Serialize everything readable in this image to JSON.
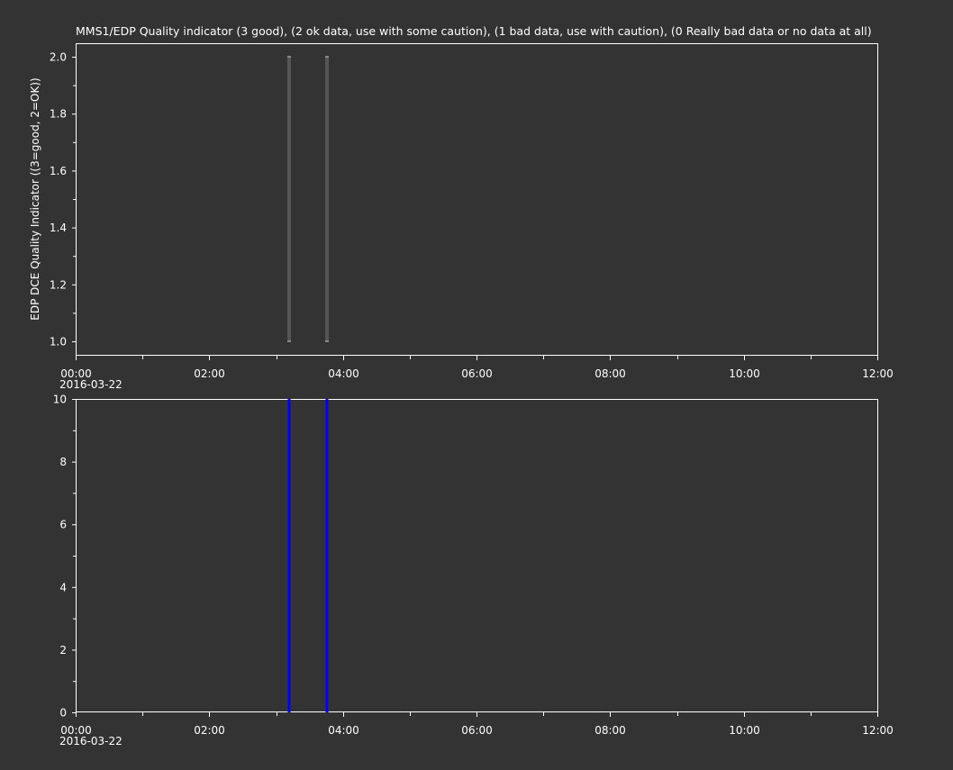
{
  "chart_data": [
    {
      "type": "line",
      "title": "MMS1/EDP  Quality indicator (3 good), (2 ok data, use with some caution), (1 bad data, use with caution), (0 Really bad data or no data at all)",
      "ylabel": "EDP DCE Quality Indicator ((3=good, 2=OK))",
      "xlabel": "",
      "x_range": [
        "00:00",
        "12:00"
      ],
      "ylim": [
        0.95,
        2.05
      ],
      "x_ticks": [
        "00:00",
        "02:00",
        "04:00",
        "06:00",
        "08:00",
        "10:00",
        "12:00"
      ],
      "x_tick_date": "2016-03-22",
      "y_ticks": [
        "1.0",
        "1.2",
        "1.4",
        "1.6",
        "1.8",
        "2.0"
      ],
      "series": [
        {
          "color": "#555555",
          "segments": [
            {
              "x": [
                "03:12",
                "03:12"
              ],
              "y": [
                1.0,
                2.0
              ]
            },
            {
              "x": [
                "03:46",
                "03:46"
              ],
              "y": [
                1.0,
                2.0
              ]
            }
          ]
        }
      ]
    },
    {
      "type": "line",
      "title": "",
      "ylabel": "",
      "xlabel": "",
      "x_range": [
        "00:00",
        "12:00"
      ],
      "ylim": [
        0,
        10
      ],
      "x_ticks": [
        "00:00",
        "02:00",
        "04:00",
        "06:00",
        "08:00",
        "10:00",
        "12:00"
      ],
      "x_tick_date": "2016-03-22",
      "y_ticks": [
        "0",
        "2",
        "4",
        "6",
        "8",
        "10"
      ],
      "series": [
        {
          "color": "#0000ff",
          "segments": [
            {
              "x": [
                "03:12",
                "03:12"
              ],
              "y": [
                0,
                10
              ]
            },
            {
              "x": [
                "03:46",
                "03:46"
              ],
              "y": [
                0,
                10
              ]
            }
          ]
        }
      ]
    }
  ]
}
